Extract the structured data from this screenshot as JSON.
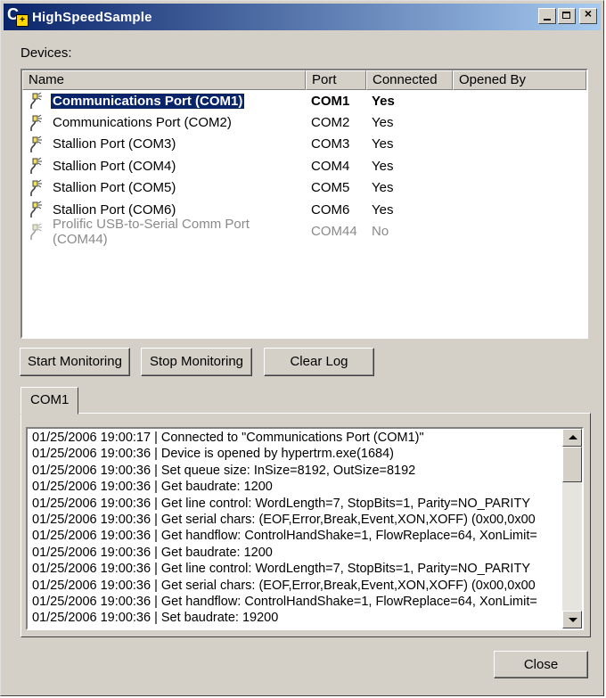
{
  "window": {
    "title": "HighSpeedSample"
  },
  "devices": {
    "label": "Devices:",
    "columns": [
      "Name",
      "Port",
      "Connected",
      "Opened By"
    ],
    "rows": [
      {
        "name": "Communications Port (COM1)",
        "port": "COM1",
        "connected": "Yes",
        "opened_by": "",
        "selected": true,
        "disabled": false
      },
      {
        "name": "Communications Port (COM2)",
        "port": "COM2",
        "connected": "Yes",
        "opened_by": "",
        "selected": false,
        "disabled": false
      },
      {
        "name": "Stallion Port (COM3)",
        "port": "COM3",
        "connected": "Yes",
        "opened_by": "",
        "selected": false,
        "disabled": false
      },
      {
        "name": "Stallion Port (COM4)",
        "port": "COM4",
        "connected": "Yes",
        "opened_by": "",
        "selected": false,
        "disabled": false
      },
      {
        "name": "Stallion Port (COM5)",
        "port": "COM5",
        "connected": "Yes",
        "opened_by": "",
        "selected": false,
        "disabled": false
      },
      {
        "name": "Stallion Port (COM6)",
        "port": "COM6",
        "connected": "Yes",
        "opened_by": "",
        "selected": false,
        "disabled": false
      },
      {
        "name": "Prolific USB-to-Serial Comm Port (COM44)",
        "port": "COM44",
        "connected": "No",
        "opened_by": "",
        "selected": false,
        "disabled": true
      }
    ]
  },
  "buttons": {
    "start": "Start Monitoring",
    "stop": "Stop Monitoring",
    "clear": "Clear Log",
    "close": "Close"
  },
  "tab": {
    "label": "COM1"
  },
  "log": {
    "lines": [
      "01/25/2006 19:00:17 | Connected to \"Communications Port (COM1)\"",
      "01/25/2006 19:00:36 | Device is opened by hypertrm.exe(1684)",
      "01/25/2006 19:00:36 | Set queue size: InSize=8192, OutSize=8192",
      "01/25/2006 19:00:36 | Get baudrate: 1200",
      "01/25/2006 19:00:36 | Get line control: WordLength=7, StopBits=1, Parity=NO_PARITY",
      "01/25/2006 19:00:36 | Get serial chars: (EOF,Error,Break,Event,XON,XOFF) (0x00,0x00",
      "01/25/2006 19:00:36 | Get handflow: ControlHandShake=1, FlowReplace=64, XonLimit=",
      "01/25/2006 19:00:36 | Get baudrate: 1200",
      "01/25/2006 19:00:36 | Get line control: WordLength=7, StopBits=1, Parity=NO_PARITY",
      "01/25/2006 19:00:36 | Get serial chars: (EOF,Error,Break,Event,XON,XOFF) (0x00,0x00",
      "01/25/2006 19:00:36 | Get handflow: ControlHandShake=1, FlowReplace=64, XonLimit=",
      "01/25/2006 19:00:36 | Set baudrate: 19200"
    ]
  }
}
